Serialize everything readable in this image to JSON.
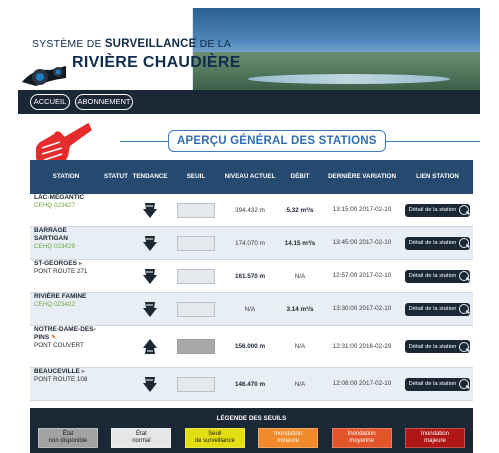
{
  "header": {
    "logo_line1_a": "SYSTÈME DE",
    "logo_line1_b": "SURVEILLANCE",
    "logo_line1_c": "DE LA",
    "logo_line2": "RIVIÈRE CHAUDIÈRE"
  },
  "nav": {
    "home_label": "ACCUEIL",
    "subscribe_label": "ABONNEMENT"
  },
  "section": {
    "title": "APERÇU GÉNÉRAL DES STATIONS"
  },
  "table": {
    "columns": [
      "STATION",
      "STATUT",
      "TENDANCE",
      "SEUIL",
      "NIVEAU ACTUEL",
      "DÉBIT",
      "DERNIÈRE VARIATION",
      "LIEN STATION"
    ],
    "rows": [
      {
        "name": "LAC-MÉGANTIC",
        "sub": "CEHQ 023427",
        "niveau": "394.432 m",
        "debit": "5.32 m³/s",
        "variation": "13:15:00 2017-02-10",
        "link": "Détail de la station",
        "trend": "down",
        "seuil": "normal"
      },
      {
        "name": "BARRAGE SARTIGAN",
        "sub": "CEHQ 023429",
        "niveau": "174.070 m",
        "debit": "14.15 m³/s",
        "variation": "13:45:00 2017-02-10",
        "link": "Détail de la station",
        "trend": "down",
        "seuil": "normal"
      },
      {
        "name": "ST-GEORGES",
        "sub": "PONT ROUTE 271",
        "niveau": "161.570 m",
        "debit": "N/A",
        "variation": "12:57:00 2017-02-10",
        "link": "Détail de la station",
        "trend": "down",
        "seuil": "normal"
      },
      {
        "name": "RIVIÈRE FAMINE",
        "sub": "CEHQ 023422",
        "niveau": "N/A",
        "debit": "3.14 m³/s",
        "variation": "13:30:00 2017-02-10",
        "link": "Détail de la station",
        "trend": "down",
        "seuil": "normal"
      },
      {
        "name": "NOTRE-DAME-DES-PINS",
        "sub": "PONT COUVERT",
        "niveau": "156.000 m",
        "debit": "N/A",
        "variation": "12:31:00 2016-02-29",
        "link": "Détail de la station",
        "trend": "up",
        "seuil": "unavailable"
      },
      {
        "name": "BEAUCEVILLE",
        "sub": "PONT ROUTE 108",
        "niveau": "146.470 m",
        "debit": "N/A",
        "variation": "12:08:00 2017-02-10",
        "link": "Détail de la station",
        "trend": "down",
        "seuil": "normal"
      }
    ]
  },
  "legend": {
    "title": "LÉGENDE DES SEUILS",
    "items": [
      {
        "line1": "État",
        "line2": "non disponible",
        "bg": "#a3a3a3",
        "fg": "#1a1a1a"
      },
      {
        "line1": "État",
        "line2": "normal",
        "bg": "#e6e6e6",
        "fg": "#1a1a1a"
      },
      {
        "line1": "Seuil",
        "line2": "de surveillance",
        "bg": "#e2de12",
        "fg": "#1a1a1a"
      },
      {
        "line1": "Inondation",
        "line2": "mineure",
        "bg": "#f08a2a",
        "fg": "#ffffff"
      },
      {
        "line1": "Inondation",
        "line2": "moyenne",
        "bg": "#e2542a",
        "fg": "#ffffff"
      },
      {
        "line1": "Inondation",
        "line2": "majeure",
        "bg": "#b01616",
        "fg": "#ffffff"
      }
    ]
  },
  "icons": {
    "trend_down": "trend-down-icon",
    "trend_up": "trend-up-icon",
    "detail": "magnifier-icon",
    "pointer": "hand-pointer-icon",
    "camera": "camera-icon"
  }
}
